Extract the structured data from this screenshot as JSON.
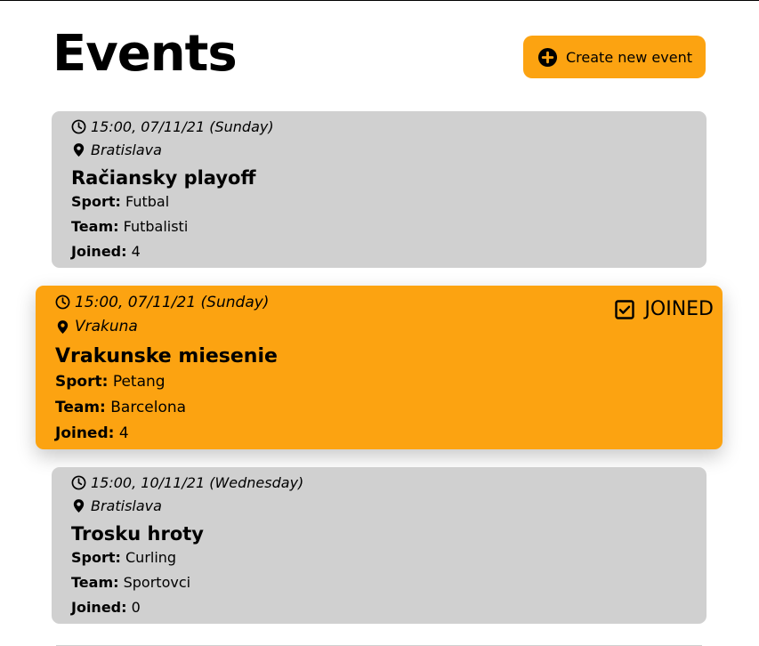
{
  "page": {
    "title": "Events",
    "create_button_label": "Create new event"
  },
  "events": [
    {
      "time": "15:00, 07/11/21 (Sunday)",
      "location": "Bratislava",
      "name": "Račiansky playoff",
      "sport_label": "Sport:",
      "sport": "Futbal",
      "team_label": "Team:",
      "team": "Futbalisti",
      "joined_label": "Joined:",
      "joined": "4",
      "is_joined": false
    },
    {
      "time": "15:00, 07/11/21 (Sunday)",
      "location": "Vrakuna",
      "name": "Vrakunske miesenie",
      "sport_label": "Sport:",
      "sport": "Petang",
      "team_label": "Team:",
      "team": "Barcelona",
      "joined_label": "Joined:",
      "joined": "4",
      "is_joined": true,
      "joined_badge": "JOINED"
    },
    {
      "time": "15:00, 10/11/21 (Wednesday)",
      "location": "Bratislava",
      "name": "Trosku hroty",
      "sport_label": "Sport:",
      "sport": "Curling",
      "team_label": "Team:",
      "team": "Sportovci",
      "joined_label": "Joined:",
      "joined": "0",
      "is_joined": false
    }
  ],
  "colors": {
    "accent": "#fca311",
    "card": "#d0d0d0"
  },
  "icons": {
    "create": "plus-circle-icon",
    "time": "clock-icon",
    "location": "map-pin-icon",
    "joined": "checkbox-checked-icon"
  }
}
